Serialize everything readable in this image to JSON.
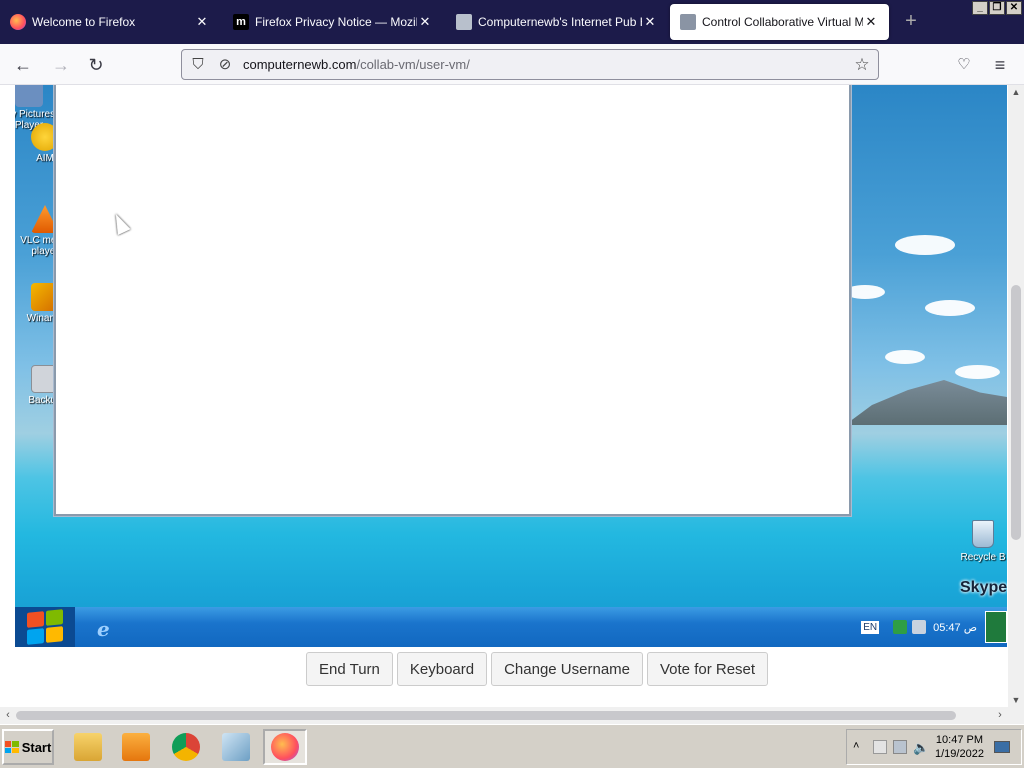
{
  "tabs": [
    {
      "label": "Welcome to Firefox",
      "icon": "firefox-icon",
      "close": "✕"
    },
    {
      "label": "Firefox Privacy Notice — Mozilla",
      "icon": "mozilla-m-icon",
      "close": "✕"
    },
    {
      "label": "Computernewb's Internet Pub Hub",
      "icon": "computer-icon",
      "close": "✕"
    },
    {
      "label": "Control Collaborative Virtual Machi",
      "icon": "computer-icon",
      "close": "✕",
      "active": true
    }
  ],
  "newtab": "+",
  "window_controls": {
    "minimize": "_",
    "restore": "❐",
    "close": "✕"
  },
  "nav": {
    "back": "←",
    "forward": "→",
    "reload": "↻",
    "url_host": "computernewb.com",
    "url_path": "/collab-vm/user-vm/"
  },
  "vm": {
    "desktop_icons": [
      "My Pictures Player",
      "AIM",
      "VLC media player",
      "Winamp",
      "Backup"
    ],
    "recycle_label": "Recycle B",
    "skype_label": "Skype",
    "tray": {
      "lang": "EN",
      "clock": "05:47 ص"
    }
  },
  "vm_buttons": {
    "end_turn": "End Turn",
    "keyboard": "Keyboard",
    "change_username": "Change Username",
    "vote_reset": "Vote for Reset"
  },
  "host_taskbar": {
    "start": "Start",
    "time": "10:47 PM",
    "date": "1/19/2022",
    "apps": [
      "file-manager-icon",
      "media-player-icon",
      "chrome-icon",
      "notepad-icon",
      "firefox-icon"
    ]
  },
  "colors": {
    "tabstrip_bg": "#1c1b4a",
    "firefox_orange": "#ff7139",
    "vm_taskbar": "#1a74cc"
  }
}
